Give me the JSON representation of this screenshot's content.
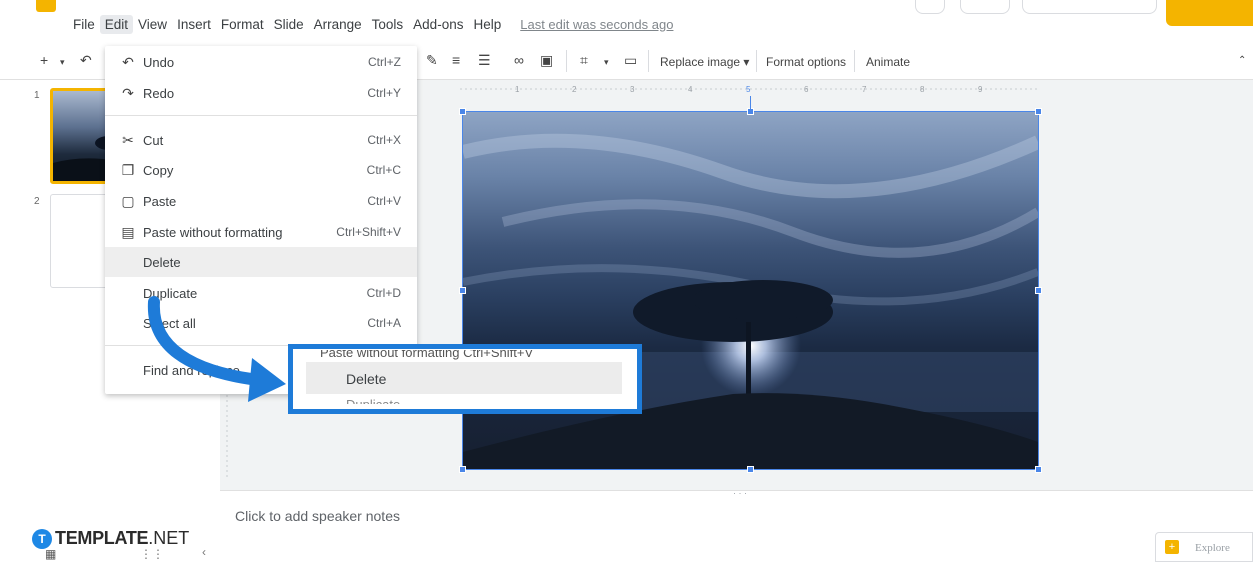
{
  "menubar": {
    "items": [
      "File",
      "Edit",
      "View",
      "Insert",
      "Format",
      "Slide",
      "Arrange",
      "Tools",
      "Add-ons",
      "Help"
    ],
    "active": "Edit",
    "last_edit": "Last edit was seconds ago"
  },
  "toolbar": {
    "replace_image": "Replace image ▾",
    "format_options": "Format options",
    "animate": "Animate"
  },
  "filmstrip": {
    "slides": [
      "1",
      "2"
    ]
  },
  "edit_menu": {
    "undo": {
      "label": "Undo",
      "shortcut": "Ctrl+Z"
    },
    "redo": {
      "label": "Redo",
      "shortcut": "Ctrl+Y"
    },
    "cut": {
      "label": "Cut",
      "shortcut": "Ctrl+X"
    },
    "copy": {
      "label": "Copy",
      "shortcut": "Ctrl+C"
    },
    "paste": {
      "label": "Paste",
      "shortcut": "Ctrl+V"
    },
    "paste_plain": {
      "label": "Paste without formatting",
      "shortcut": "Ctrl+Shift+V"
    },
    "delete": {
      "label": "Delete"
    },
    "duplicate": {
      "label": "Duplicate",
      "shortcut": "Ctrl+D"
    },
    "select_all": {
      "label": "Select all",
      "shortcut": "Ctrl+A"
    },
    "find_replace": {
      "label": "Find and replace"
    }
  },
  "zoom_callout": {
    "label": "Delete",
    "clipped_top": "Paste without formatting     Ctrl+Shift+V",
    "clipped_bottom": "Duplicate"
  },
  "notes": {
    "placeholder": "Click to add speaker notes"
  },
  "explore": {
    "label": "Explore"
  },
  "brand": {
    "letter": "T",
    "name": "TEMPLATE",
    "suffix": ".NET"
  },
  "colors": {
    "accent": "#f4b400",
    "selection": "#4a86e8",
    "callout": "#1e7bd8"
  }
}
